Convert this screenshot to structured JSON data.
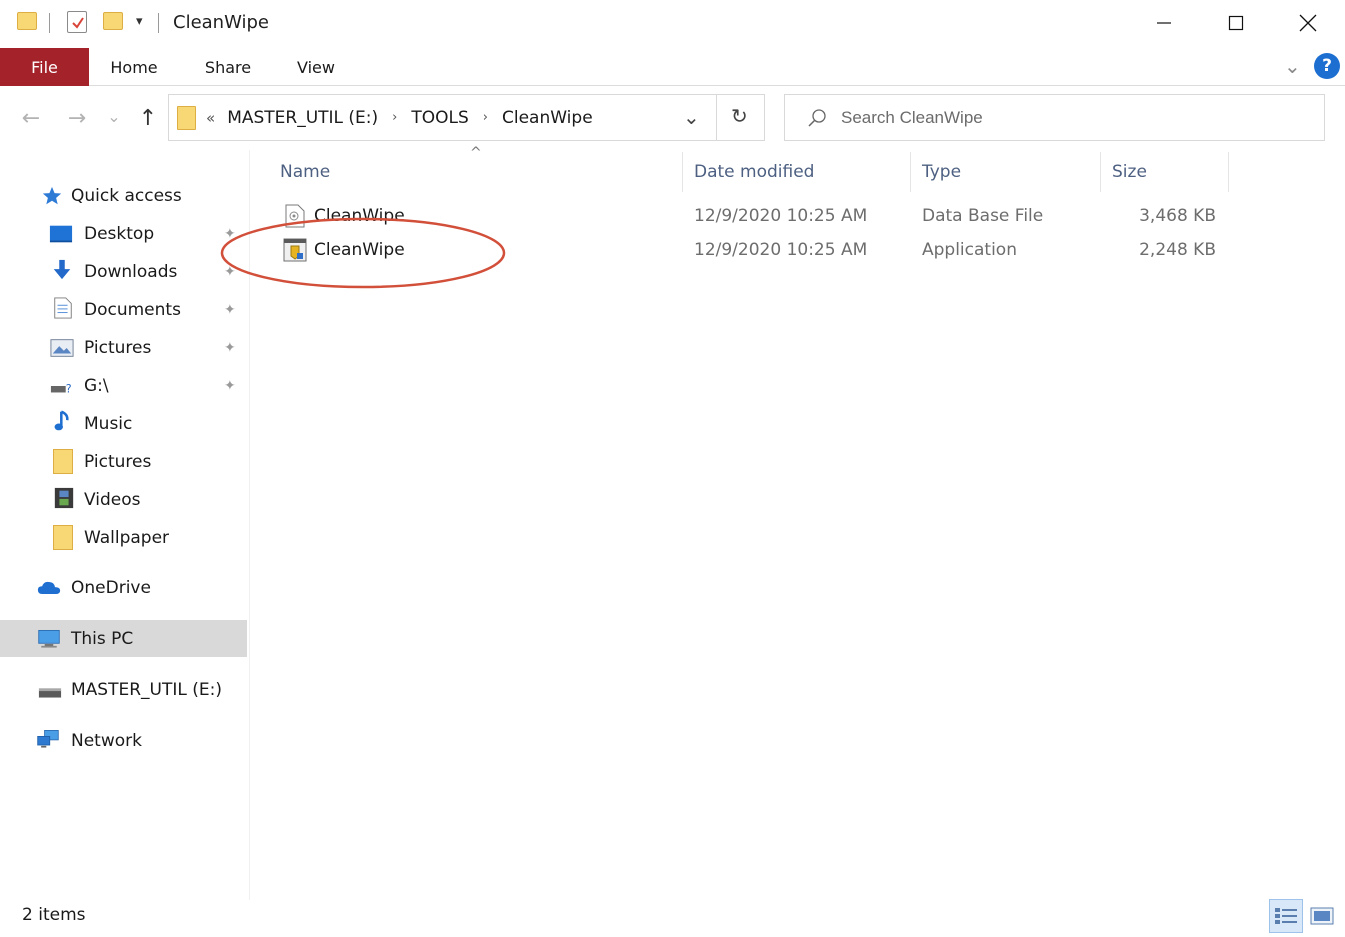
{
  "window": {
    "title": "CleanWipe",
    "controls": {
      "minimize": "—",
      "maximize": "☐",
      "close": "✕"
    },
    "quick_access_toolbar": {
      "dropdown": "▾"
    }
  },
  "ribbon": {
    "tabs": [
      {
        "label": "File",
        "active_color": "#a4232b"
      },
      {
        "label": "Home"
      },
      {
        "label": "Share"
      },
      {
        "label": "View"
      }
    ],
    "collapse_glyph": "⌄",
    "help_label": "?"
  },
  "navigation": {
    "back_glyph": "←",
    "forward_glyph": "→",
    "recent_glyph": "⌄",
    "up_glyph": "↑",
    "refresh_glyph": "↻"
  },
  "address": {
    "overflow": "«",
    "crumbs": [
      "MASTER_UTIL (E:)",
      "TOOLS",
      "CleanWipe"
    ],
    "separator": "›",
    "dropdown_glyph": "⌄"
  },
  "search": {
    "placeholder": "Search CleanWipe"
  },
  "sidebar": {
    "quick_access": {
      "label": "Quick access",
      "items": [
        {
          "label": "Desktop",
          "icon": "desktop-icon",
          "pinned": true
        },
        {
          "label": "Downloads",
          "icon": "downloads-icon",
          "pinned": true
        },
        {
          "label": "Documents",
          "icon": "documents-icon",
          "pinned": true
        },
        {
          "label": "Pictures",
          "icon": "pictures-icon",
          "pinned": true
        },
        {
          "label": "G:\\",
          "icon": "network-drive-icon",
          "pinned": true
        },
        {
          "label": "Music",
          "icon": "music-icon",
          "pinned": false
        },
        {
          "label": "Pictures",
          "icon": "folder-icon",
          "pinned": false
        },
        {
          "label": "Videos",
          "icon": "videos-icon",
          "pinned": false
        },
        {
          "label": "Wallpaper",
          "icon": "folder-icon",
          "pinned": false
        }
      ]
    },
    "onedrive": "OneDrive",
    "this_pc": "This PC",
    "drive": "MASTER_UTIL (E:)",
    "network": "Network",
    "pin_glyph": "📌"
  },
  "file_list": {
    "sort_glyph": "^",
    "columns": {
      "name": "Name",
      "date": "Date modified",
      "type": "Type",
      "size": "Size"
    },
    "rows": [
      {
        "name": "CleanWipe",
        "date": "12/9/2020 10:25 AM",
        "type": "Data Base File",
        "size": "3,468 KB",
        "icon": "database-file-icon"
      },
      {
        "name": "CleanWipe",
        "date": "12/9/2020 10:25 AM",
        "type": "Application",
        "size": "2,248 KB",
        "icon": "application-icon",
        "highlighted": true
      }
    ],
    "highlight_color": "#d24f3a"
  },
  "status_bar": {
    "item_count": "2 items"
  }
}
